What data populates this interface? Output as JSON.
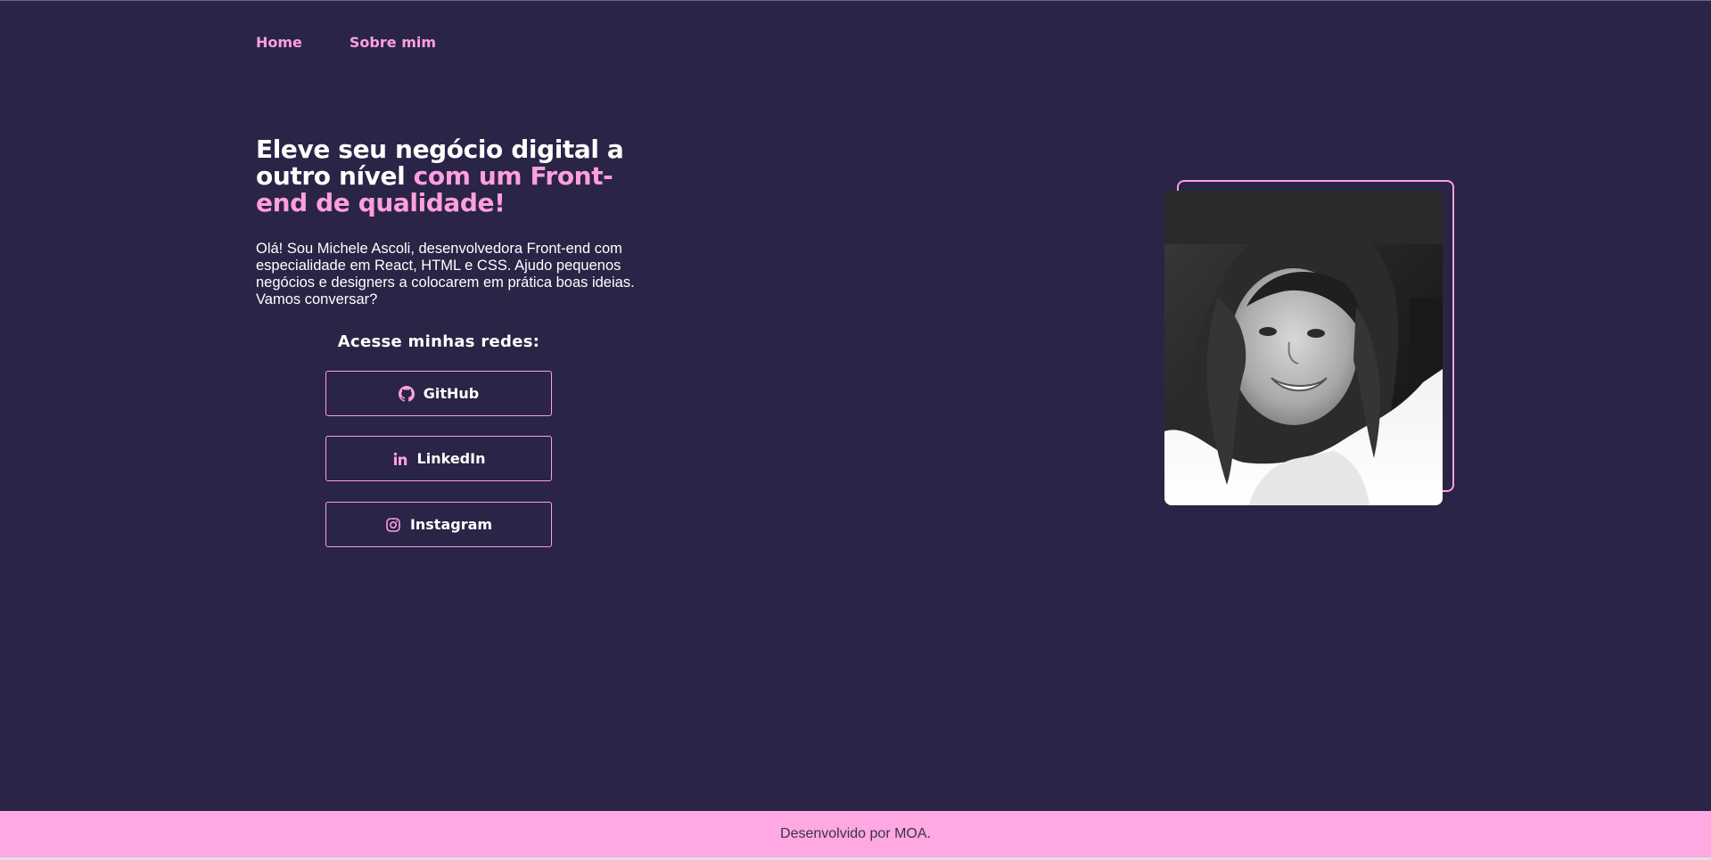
{
  "nav": {
    "items": [
      {
        "label": "Home"
      },
      {
        "label": "Sobre mim"
      }
    ]
  },
  "hero": {
    "title_white": "Eleve seu negócio digital a outro nível ",
    "title_accent": "com um Front-end de qualidade!",
    "intro": "Olá! Sou Michele Ascoli, desenvolvedora Front-end com especialidade em React, HTML e CSS. Ajudo pequenos negócios e designers a colocarem em prática boas ideias. Vamos conversar?"
  },
  "social": {
    "heading": "Acesse minhas redes:",
    "buttons": [
      {
        "label": "GitHub",
        "icon": "github-icon"
      },
      {
        "label": "LinkedIn",
        "icon": "linkedin-icon"
      },
      {
        "label": "Instagram",
        "icon": "instagram-icon"
      }
    ]
  },
  "footer": {
    "text": "Desenvolvido por MOA."
  },
  "colors": {
    "background": "#2a2446",
    "accent": "#ff9fde",
    "footer_bg": "#ffa8e2",
    "text": "#ffffff"
  }
}
